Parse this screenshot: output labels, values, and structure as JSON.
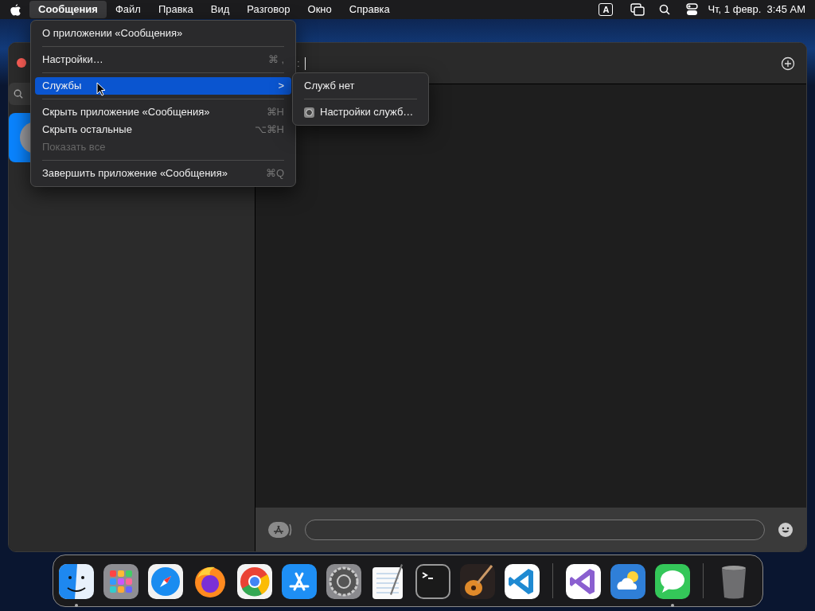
{
  "menu_bar": {
    "menus": [
      {
        "label": "Сообщения",
        "selected": true
      },
      {
        "label": "Файл",
        "selected": false
      },
      {
        "label": "Правка",
        "selected": false
      },
      {
        "label": "Вид",
        "selected": false
      },
      {
        "label": "Разговор",
        "selected": false
      },
      {
        "label": "Окно",
        "selected": false
      },
      {
        "label": "Справка",
        "selected": false
      }
    ],
    "input_source": "A",
    "clock": "Чт, 1 февр.  3:45 AM"
  },
  "window": {
    "to_field": {
      "label": ":"
    }
  },
  "app_menu": {
    "items": [
      {
        "kind": "item",
        "label": "О приложении «Сообщения»",
        "disabled": false,
        "selected": false
      },
      {
        "kind": "separator"
      },
      {
        "kind": "item",
        "label": "Настройки…",
        "shortcut": "⌘ ,",
        "disabled": false,
        "selected": false
      },
      {
        "kind": "separator"
      },
      {
        "kind": "submenu",
        "label": "Службы",
        "arrow": ">",
        "disabled": false,
        "selected": true
      },
      {
        "kind": "separator"
      },
      {
        "kind": "item",
        "label": "Скрыть приложение «Сообщения»",
        "shortcut": "⌘H",
        "disabled": false,
        "selected": false
      },
      {
        "kind": "item",
        "label": "Скрыть остальные",
        "shortcut": "⌥⌘H",
        "disabled": false,
        "selected": false
      },
      {
        "kind": "item",
        "label": "Показать все",
        "disabled": true,
        "selected": false
      },
      {
        "kind": "separator"
      },
      {
        "kind": "item",
        "label": "Завершить приложение «Сообщения»",
        "shortcut": "⌘Q",
        "disabled": false,
        "selected": false
      }
    ]
  },
  "services_submenu": {
    "items": [
      {
        "kind": "item",
        "label": "Служб нет"
      },
      {
        "kind": "separator"
      },
      {
        "kind": "settings",
        "label": "Настройки служб…"
      }
    ]
  },
  "dock": {
    "items": [
      {
        "kind": "finder",
        "running": true
      },
      {
        "kind": "launchpad",
        "running": false
      },
      {
        "kind": "safari",
        "running": false
      },
      {
        "kind": "firefox",
        "running": false
      },
      {
        "kind": "chrome",
        "running": false
      },
      {
        "kind": "appstore",
        "running": false
      },
      {
        "kind": "settings",
        "running": false
      },
      {
        "kind": "textedit",
        "running": false
      },
      {
        "kind": "terminal",
        "running": false
      },
      {
        "kind": "garageband",
        "running": false
      },
      {
        "kind": "vscode",
        "running": false
      },
      {
        "kind": "separator"
      },
      {
        "kind": "visualstudio",
        "running": false
      },
      {
        "kind": "weather",
        "running": false
      },
      {
        "kind": "messages",
        "running": true
      },
      {
        "kind": "separator"
      },
      {
        "kind": "trash",
        "running": false
      }
    ]
  }
}
